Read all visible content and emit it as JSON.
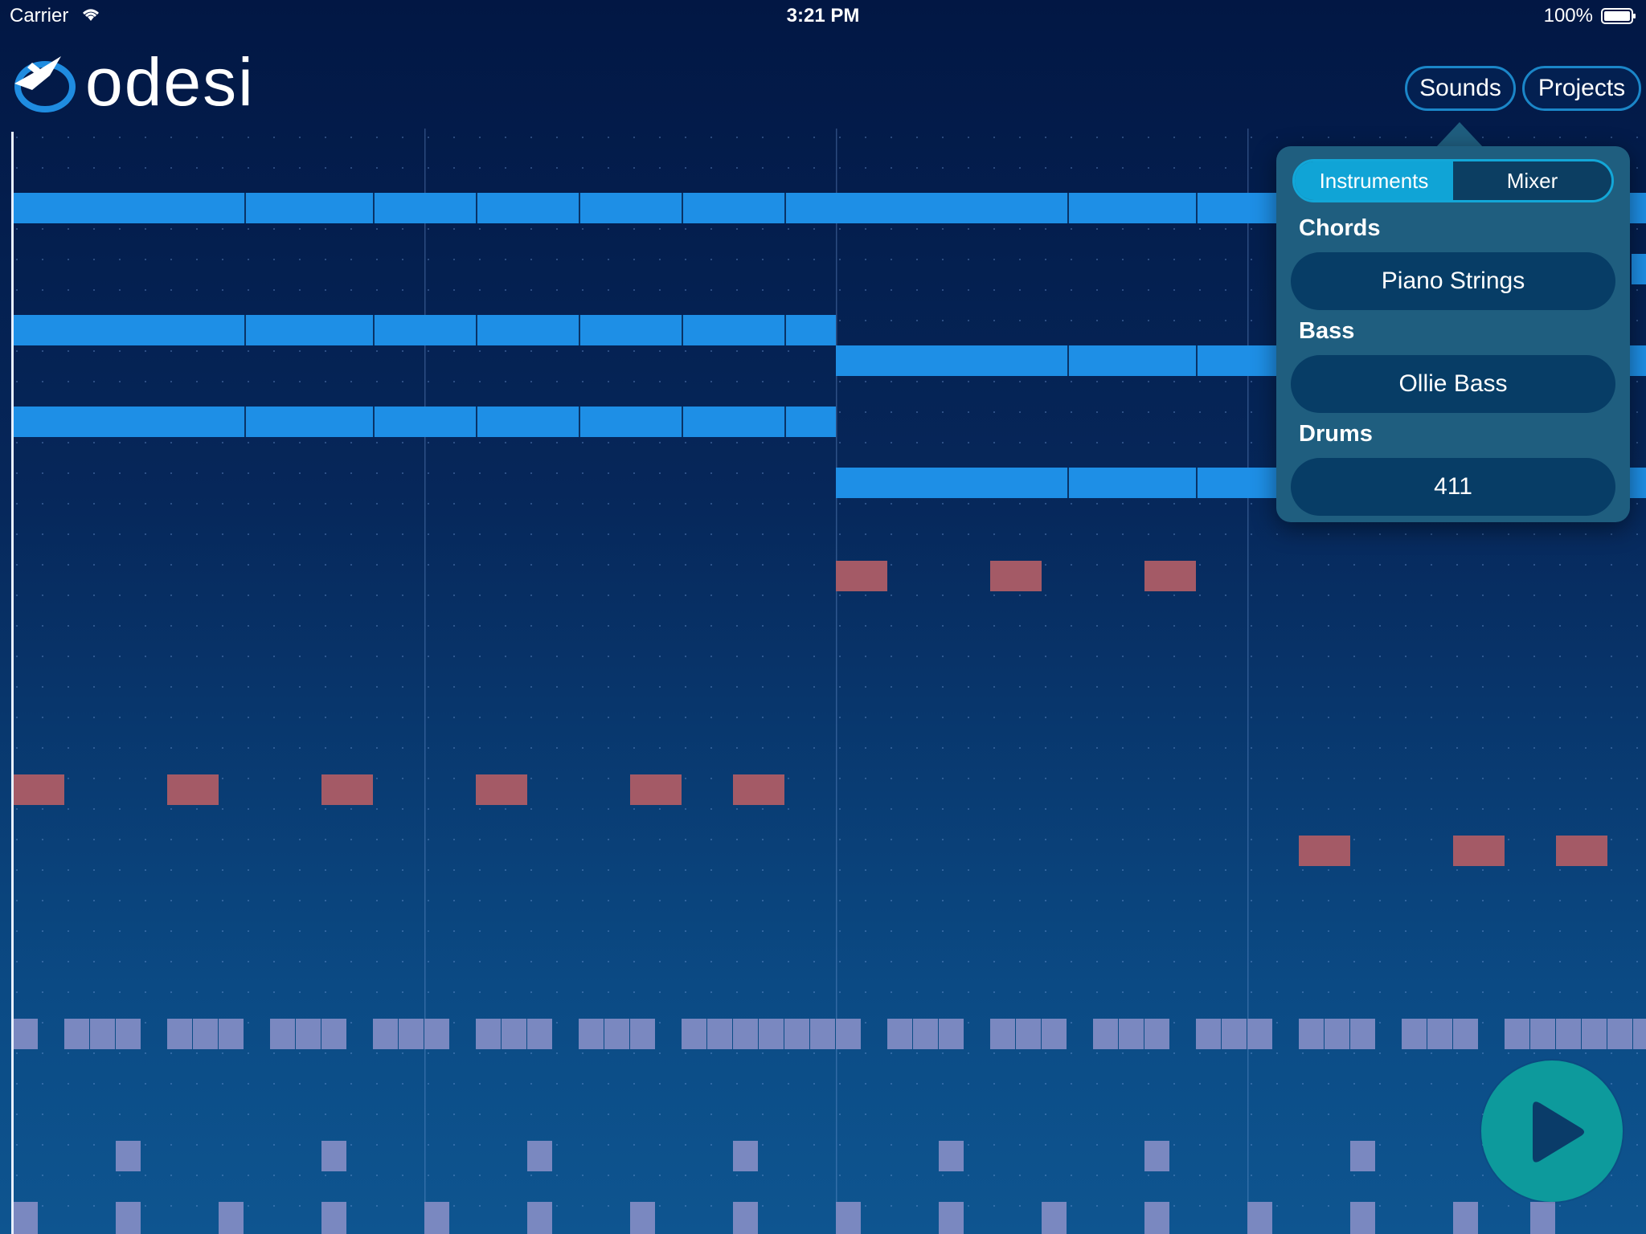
{
  "status_bar": {
    "carrier": "Carrier",
    "time": "3:21 PM",
    "battery_percent": "100%",
    "wifi_icon": "wifi-icon",
    "battery_icon": "battery-icon"
  },
  "header": {
    "brand": "odesi",
    "logo_icon": "odesi-logo-icon",
    "sounds_label": "Sounds",
    "projects_label": "Projects"
  },
  "popover": {
    "tabs": [
      "Instruments",
      "Mixer"
    ],
    "selected_tab": "Instruments",
    "sections": [
      {
        "label": "Chords",
        "value": "Piano Strings"
      },
      {
        "label": "Bass",
        "value": "Ollie Bass"
      },
      {
        "label": "Drums",
        "value": "411"
      }
    ]
  },
  "play_button": {
    "icon": "play-icon"
  },
  "colors": {
    "chord_note": "#1e8fe6",
    "bass_note": "#a45a66",
    "drum_note": "#7a88c0",
    "accent": "#10a4d6",
    "play_button": "#0d9a9c"
  }
}
